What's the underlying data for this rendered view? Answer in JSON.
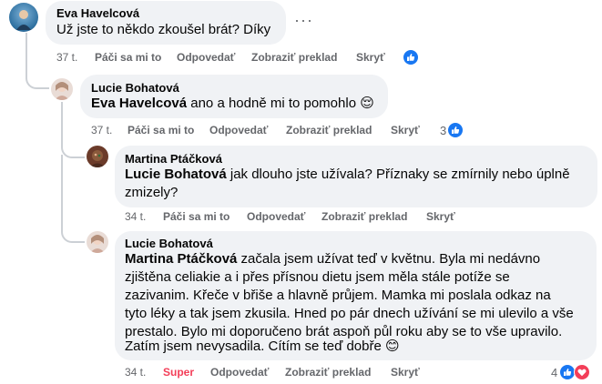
{
  "comments": [
    {
      "author": "Eva Havelcová",
      "text": "Už jste to někdo zkoušel brát? Díky",
      "actions": {
        "time": "37 t.",
        "like": "Páči sa mi to",
        "reply": "Odpovedať",
        "translate": "Zobraziť preklad",
        "hide": "Skryť"
      },
      "reactions": {
        "types": [
          "like"
        ],
        "count": ""
      }
    },
    {
      "author": "Lucie Bohatová",
      "mention": "Eva Havelcová",
      "text": " ano a hodně mi to pomohlo 😌",
      "actions": {
        "time": "37 t.",
        "like": "Páči sa mi to",
        "reply": "Odpovedať",
        "translate": "Zobraziť preklad",
        "hide": "Skryť"
      },
      "reactions": {
        "types": [
          "like"
        ],
        "count": "3"
      }
    },
    {
      "author": "Martina Ptáčková",
      "mention": "Lucie Bohatová",
      "text_line1": " jak dlouho jste užívala? Příznaky se zmírnily nebo úplně",
      "text_line2": "zmizely?",
      "actions": {
        "time": "34 t.",
        "like": "Páči sa mi to",
        "reply": "Odpovedať",
        "translate": "Zobraziť preklad",
        "hide": "Skryť"
      }
    },
    {
      "author": "Lucie Bohatová",
      "mention": "Martina Ptáčková",
      "lines": [
        " začala jsem užívat teď v květnu. Byla mi nedávno",
        "zjištěna celiakie a i přes přísnou dietu jsem měla stále potíže se",
        "zazivanim. Křeče v břiše a hlavně průjem. Mamka mi poslala odkaz na",
        "tyto léky a tak jsem zkusila. Hned po pár dnech užívání se mi ulevilo a vše",
        "prestalo. Bylo mi doporučeno brát aspoň půl roku aby se to vše upravilo.",
        "Zatím jsem nevysadila. Cítím se teď dobře 😊"
      ],
      "actions": {
        "time": "34 t.",
        "like": "Super",
        "reply": "Odpovedať",
        "translate": "Zobraziť preklad",
        "hide": "Skryť"
      },
      "reactions": {
        "types": [
          "like",
          "love"
        ],
        "count": "4"
      }
    }
  ],
  "more_menu": "···",
  "colors": {
    "bubble": "#f0f2f5",
    "like_blue": "#1877f2",
    "love_red": "#f33e58",
    "meta_gray": "#65676b",
    "thread_line": "#ccd0d5"
  }
}
